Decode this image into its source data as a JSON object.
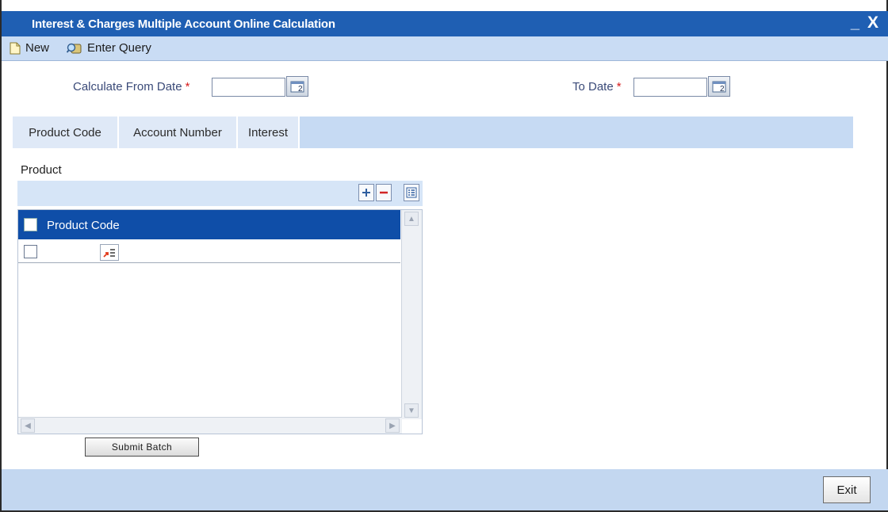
{
  "window": {
    "title": "Interest & Charges Multiple Account Online Calculation",
    "minimize": "_",
    "close": "X"
  },
  "toolbar": {
    "new_label": "New",
    "enter_query_label": "Enter Query"
  },
  "form": {
    "from_date_label": "Calculate From Date",
    "to_date_label": "To Date",
    "required_marker": "*",
    "from_date_value": "",
    "to_date_value": ""
  },
  "tabs": [
    {
      "label": "Product Code"
    },
    {
      "label": "Account Number"
    },
    {
      "label": "Interest"
    }
  ],
  "product_section": {
    "title": "Product",
    "column_header": "Product Code",
    "rows": [
      {
        "product_code": ""
      }
    ]
  },
  "buttons": {
    "submit_batch": "Submit Batch",
    "exit": "Exit"
  },
  "colors": {
    "title_bar": "#1f5fb3",
    "toolbar": "#c9dcf4",
    "grid_header": "#0f4ea8",
    "footer": "#c3d7f0",
    "required": "#d61b1b"
  }
}
